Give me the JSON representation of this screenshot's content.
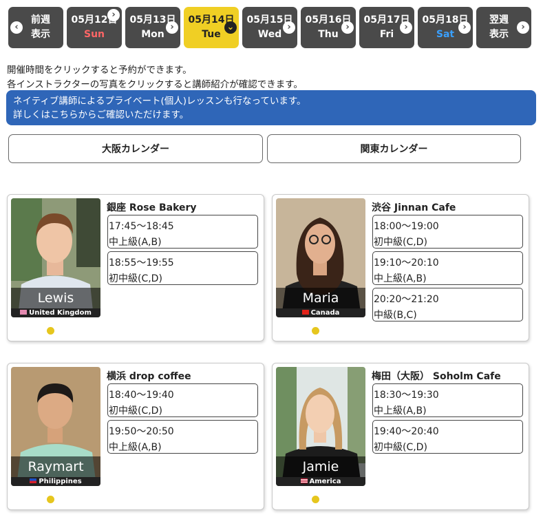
{
  "datebar": {
    "prev": {
      "line1": "前週",
      "line2": "表示"
    },
    "next": {
      "line1": "翌週",
      "line2": "表示"
    },
    "days": [
      {
        "date": "05月12日",
        "weekday": "Sun",
        "arrow": "›"
      },
      {
        "date": "05月13日",
        "weekday": "Mon",
        "arrow": "›"
      },
      {
        "date": "05月14日",
        "weekday": "Tue",
        "arrow": "⌄"
      },
      {
        "date": "05月15日",
        "weekday": "Wed",
        "arrow": "›"
      },
      {
        "date": "05月16日",
        "weekday": "Thu",
        "arrow": "›"
      },
      {
        "date": "05月17日",
        "weekday": "Fri",
        "arrow": "›"
      },
      {
        "date": "05月18日",
        "weekday": "Sat",
        "arrow": "›"
      }
    ],
    "prev_arrow": "‹",
    "next_arrow": "›"
  },
  "notes": {
    "line1": "開催時間をクリックすると予約ができます。",
    "line2": "各インストラクターの写真をクリックすると講師紹介が確認できます。"
  },
  "banner": {
    "line1": "ネイティブ講師によるプライベート(個人)レッスンも行なっています。",
    "line2": "詳しくはこちらからご確認いただけます。"
  },
  "calendars": {
    "osaka": "大阪カレンダー",
    "kanto": "関東カレンダー"
  },
  "colors": {
    "active_day": "#f0cf24",
    "banner": "#2f66b8",
    "dark_button": "#4a4a4a",
    "sunday": "#ff6666",
    "saturday": "#3aa0ff"
  },
  "lessons": [
    {
      "teacher": "Lewis",
      "country": "United Kingdom",
      "flag_icon": "uk-flag-icon",
      "venue": "銀座 Rose Bakery",
      "slots": [
        {
          "time": "17:45～18:45",
          "level": "中上級(A,B)"
        },
        {
          "time": "18:55～19:55",
          "level": "初中級(C,D)"
        }
      ]
    },
    {
      "teacher": "Maria",
      "country": "Canada",
      "flag_icon": "canada-flag-icon",
      "venue": "渋谷 Jinnan Cafe",
      "slots": [
        {
          "time": "18:00～19:00",
          "level": "初中級(C,D)"
        },
        {
          "time": "19:10～20:10",
          "level": "中上級(A,B)"
        },
        {
          "time": "20:20～21:20",
          "level": "中級(B,C)"
        }
      ]
    },
    {
      "teacher": "Raymart",
      "country": "Philippines",
      "flag_icon": "philippines-flag-icon",
      "venue": "横浜 drop coffee",
      "slots": [
        {
          "time": "18:40～19:40",
          "level": "初中級(C,D)"
        },
        {
          "time": "19:50～20:50",
          "level": "中上級(A,B)"
        }
      ]
    },
    {
      "teacher": "Jamie",
      "country": "America",
      "flag_icon": "usa-flag-icon",
      "venue": "梅田（大阪） Soholm Cafe",
      "slots": [
        {
          "time": "18:30～19:30",
          "level": "中上級(A,B)"
        },
        {
          "time": "19:40～20:40",
          "level": "初中級(C,D)"
        }
      ]
    }
  ]
}
